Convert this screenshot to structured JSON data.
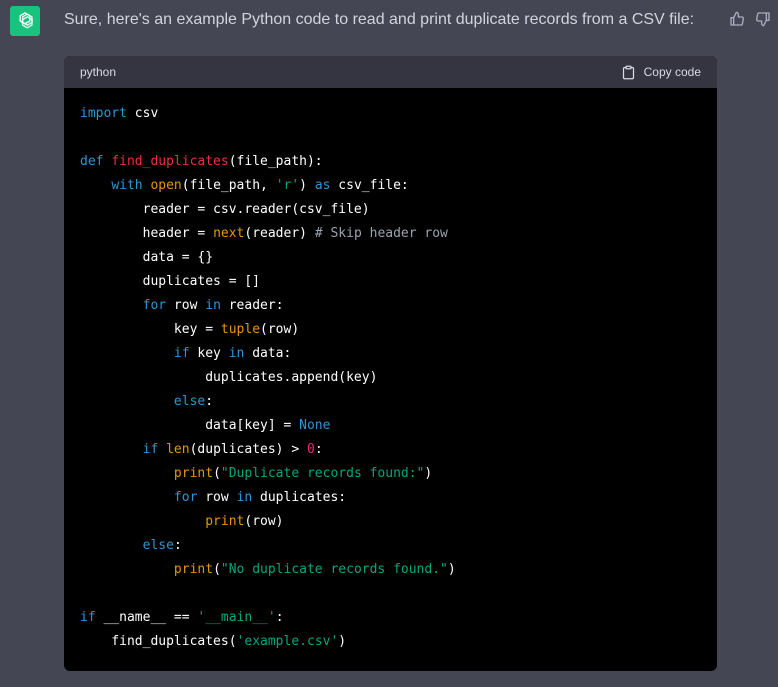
{
  "message": {
    "avatar_icon": "openai-logo-icon",
    "avatar_color": "#19c37d",
    "intro": "Sure, here's an example Python code to read and print duplicate records from a CSV file:"
  },
  "feedback": {
    "thumbs_up_icon": "thumbs-up-icon",
    "thumbs_down_icon": "thumbs-down-icon"
  },
  "code_block": {
    "language": "python",
    "copy_label": "Copy code",
    "copy_icon": "clipboard-icon",
    "header_bg": "#343541",
    "body_bg": "#000000",
    "lines": [
      [
        [
          "kw",
          "import"
        ],
        [
          "p",
          " csv"
        ]
      ],
      [],
      [
        [
          "kw",
          "def"
        ],
        [
          "p",
          " "
        ],
        [
          "fn",
          "find_duplicates"
        ],
        [
          "p",
          "(file_path):"
        ]
      ],
      [
        [
          "p",
          "    "
        ],
        [
          "kw",
          "with"
        ],
        [
          "p",
          " "
        ],
        [
          "bi",
          "open"
        ],
        [
          "p",
          "(file_path, "
        ],
        [
          "str",
          "'r'"
        ],
        [
          "p",
          ") "
        ],
        [
          "kw",
          "as"
        ],
        [
          "p",
          " csv_file:"
        ]
      ],
      [
        [
          "p",
          "        reader = csv.reader(csv_file)"
        ]
      ],
      [
        [
          "p",
          "        header = "
        ],
        [
          "bi",
          "next"
        ],
        [
          "p",
          "(reader) "
        ],
        [
          "cm",
          "# Skip header row"
        ]
      ],
      [
        [
          "p",
          "        data = {}"
        ]
      ],
      [
        [
          "p",
          "        duplicates = []"
        ]
      ],
      [
        [
          "p",
          "        "
        ],
        [
          "kw",
          "for"
        ],
        [
          "p",
          " row "
        ],
        [
          "kw",
          "in"
        ],
        [
          "p",
          " reader:"
        ]
      ],
      [
        [
          "p",
          "            key = "
        ],
        [
          "bi",
          "tuple"
        ],
        [
          "p",
          "(row)"
        ]
      ],
      [
        [
          "p",
          "            "
        ],
        [
          "kw",
          "if"
        ],
        [
          "p",
          " key "
        ],
        [
          "kw",
          "in"
        ],
        [
          "p",
          " data:"
        ]
      ],
      [
        [
          "p",
          "                duplicates.append(key)"
        ]
      ],
      [
        [
          "p",
          "            "
        ],
        [
          "kw",
          "else"
        ],
        [
          "p",
          ":"
        ]
      ],
      [
        [
          "p",
          "                data[key] = "
        ],
        [
          "kw",
          "None"
        ]
      ],
      [
        [
          "p",
          "        "
        ],
        [
          "kw",
          "if"
        ],
        [
          "p",
          " "
        ],
        [
          "bi",
          "len"
        ],
        [
          "p",
          "(duplicates) > "
        ],
        [
          "num",
          "0"
        ],
        [
          "p",
          ":"
        ]
      ],
      [
        [
          "p",
          "            "
        ],
        [
          "bi",
          "print"
        ],
        [
          "p",
          "("
        ],
        [
          "str",
          "\"Duplicate records found:\""
        ],
        [
          "p",
          ")"
        ]
      ],
      [
        [
          "p",
          "            "
        ],
        [
          "kw",
          "for"
        ],
        [
          "p",
          " row "
        ],
        [
          "kw",
          "in"
        ],
        [
          "p",
          " duplicates:"
        ]
      ],
      [
        [
          "p",
          "                "
        ],
        [
          "bi",
          "print"
        ],
        [
          "p",
          "(row)"
        ]
      ],
      [
        [
          "p",
          "        "
        ],
        [
          "kw",
          "else"
        ],
        [
          "p",
          ":"
        ]
      ],
      [
        [
          "p",
          "            "
        ],
        [
          "bi",
          "print"
        ],
        [
          "p",
          "("
        ],
        [
          "str",
          "\"No duplicate records found.\""
        ],
        [
          "p",
          ")"
        ]
      ],
      [],
      [
        [
          "kw",
          "if"
        ],
        [
          "p",
          " __name__ == "
        ],
        [
          "str",
          "'__main__'"
        ],
        [
          "p",
          ":"
        ]
      ],
      [
        [
          "p",
          "    find_duplicates("
        ],
        [
          "str",
          "'example.csv'"
        ],
        [
          "p",
          ")"
        ]
      ]
    ]
  },
  "colors": {
    "page_bg": "#444654",
    "text": "#d1d5db",
    "keyword": "#2e95d3",
    "function_name": "#f22c3d",
    "builtin": "#e9950c",
    "string": "#00a67d",
    "comment": "#9ca3af",
    "number": "#df3079"
  }
}
